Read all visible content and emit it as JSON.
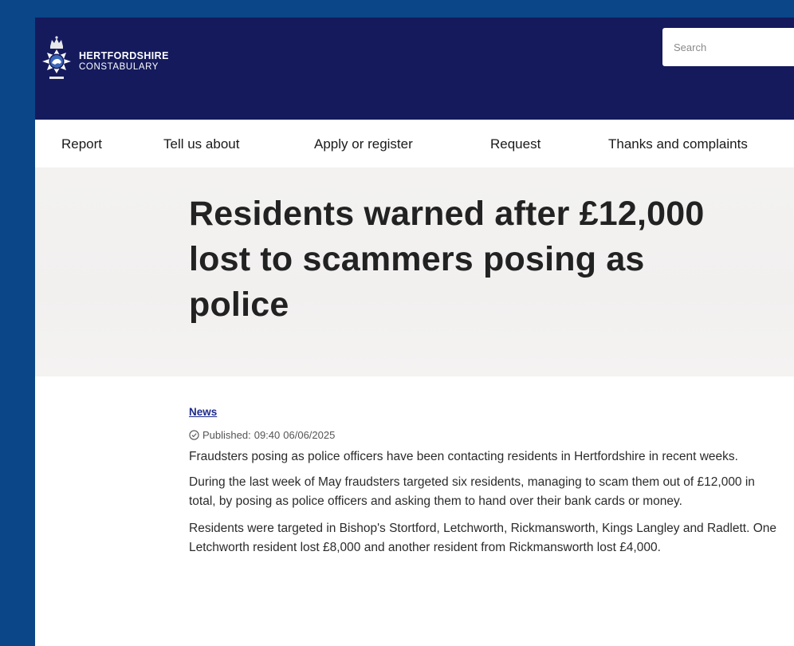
{
  "header": {
    "logo_line1": "HERTFORDSHIRE",
    "logo_line2": "CONSTABULARY",
    "search_placeholder": "Search"
  },
  "nav": {
    "items": [
      {
        "label": "Report"
      },
      {
        "label": "Tell us about"
      },
      {
        "label": "Apply or register"
      },
      {
        "label": "Request"
      },
      {
        "label": "Thanks and complaints"
      }
    ]
  },
  "article": {
    "title": "Residents warned after £12,000 lost to scammers posing as police",
    "category": "News",
    "published_label": "Published:",
    "published_time": "09:40",
    "published_date": "06/06/2025",
    "paragraphs": [
      "Fraudsters posing as police officers have been contacting residents in Hertfordshire in recent weeks.",
      "During the last week of May fraudsters targeted six residents, managing to scam them out of £12,000 in total, by posing as police officers and asking them to hand over their bank cards or money.",
      "Residents were targeted in Bishop's Stortford, Letchworth, Rickmansworth, Kings Langley and Radlett. One Letchworth resident lost £8,000 and another resident from Rickmansworth lost £4,000."
    ]
  },
  "colors": {
    "frame_blue": "#0a4688",
    "header_navy": "#141a5c",
    "link_blue": "#1d2a8a"
  },
  "icons": {
    "crest": "police-crest-icon",
    "published": "check-circle-icon"
  }
}
